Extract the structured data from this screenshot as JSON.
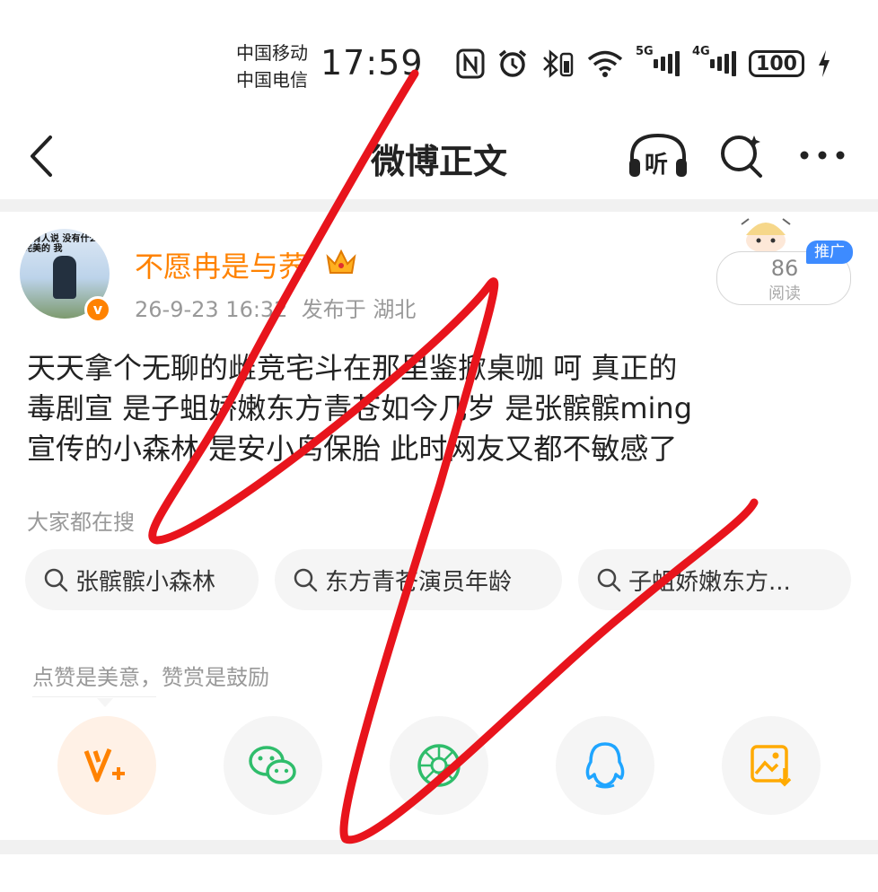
{
  "status_bar": {
    "carrier_1": "中国移动",
    "carrier_2": "中国电信",
    "time": "17:59",
    "network_1": "5G",
    "network_2": "4G",
    "battery": "100",
    "icons": [
      "nfc-icon",
      "alarm-icon",
      "bluetooth-icon",
      "wifi-icon",
      "signal-icon",
      "battery-icon",
      "charging-icon"
    ]
  },
  "nav": {
    "title": "微博正文",
    "listen_label": "听"
  },
  "post": {
    "author": "不愿冉是与荞",
    "avatar_caption": "当有人说 没有什么是完美的 我",
    "timestamp": "26-9-23 16:32",
    "location": "发布于 湖北",
    "read_count": "86",
    "read_label": "阅读",
    "promo_badge": "推广",
    "text": "天天拿个无聊的雌竞宅斗在那里鉴掀桌咖  呵 真正的\n毒剧宣 是子蛆娇嫩东方青苍如今几岁 是张髌髌ming\n宣传的小森林  是安小鸟保胎  此时网友又都不敏感了"
  },
  "trending": {
    "hint": "大家都在搜",
    "chips": [
      "张髌髌小森林",
      "东方青苍演员年龄",
      "子蛆娇嫩东方..."
    ]
  },
  "share": {
    "tip": "点赞是美意，赞赏是鼓励",
    "buttons": [
      "reward-icon",
      "wechat-icon",
      "moments-icon",
      "qq-icon",
      "save-image-icon"
    ]
  },
  "colors": {
    "accent": "#ff8200",
    "promo": "#3d8bff",
    "wechat": "#2fbd6b",
    "qq": "#1fa5ff",
    "scribble": "#e8141c"
  }
}
